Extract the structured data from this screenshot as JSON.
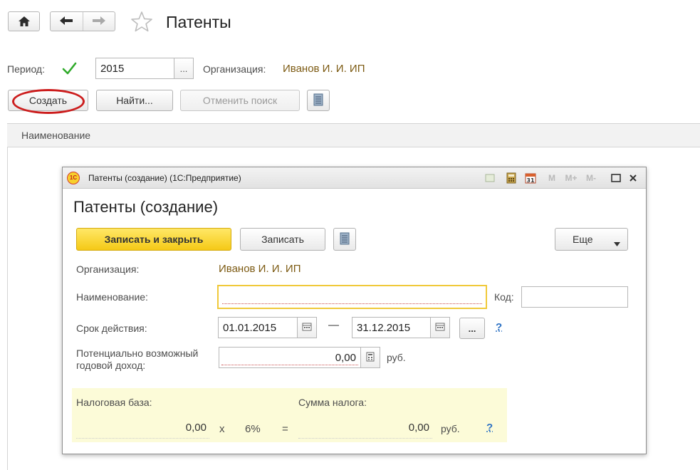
{
  "main": {
    "title": "Патенты",
    "period_label": "Период:",
    "period_value": "2015",
    "period_select_btn": "...",
    "org_label": "Организация:",
    "org_value": "Иванов И. И. ИП",
    "buttons": {
      "create": "Создать",
      "find": "Найти...",
      "cancel_search": "Отменить поиск"
    },
    "list": {
      "columns": [
        "Наименование"
      ]
    }
  },
  "modal": {
    "window_title": "Патенты (создание)  (1С:Предприятие)",
    "title": "Патенты (создание)",
    "toolbar_icons": [
      "M",
      "M+",
      "M-"
    ],
    "buttons": {
      "save_close": "Записать и закрыть",
      "save": "Записать",
      "more": "Еще"
    },
    "org_label": "Организация:",
    "org_value": "Иванов И. И. ИП",
    "name_label": "Наименование:",
    "name_value": "",
    "code_label": "Код:",
    "code_value": "",
    "term_label": "Срок действия:",
    "term_from": "01.01.2015",
    "term_dash": "—",
    "term_to": "31.12.2015",
    "term_more_btn": "...",
    "income_label_1": "Потенциально возможный",
    "income_label_2": "годовой доход:",
    "income_value": "0,00",
    "currency": "руб.",
    "help": "?",
    "tax": {
      "base_label": "Налоговая база:",
      "sum_label": "Сумма налога:",
      "base_value": "0,00",
      "times": "x",
      "rate": "6%",
      "equals": "=",
      "sum_value": "0,00",
      "currency": "руб.",
      "help": "?"
    }
  },
  "colors": {
    "link": "#7c5a12",
    "accent_yellow": "#f5c916",
    "highlight_circle": "#cc1d1d",
    "tax_panel_bg": "#fcfbd8",
    "help_link": "#2d72c4"
  }
}
